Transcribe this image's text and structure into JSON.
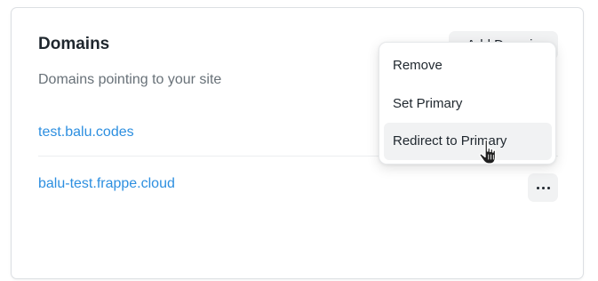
{
  "section": {
    "title": "Domains",
    "subtitle": "Domains pointing to your site",
    "add_button_label": "Add Domain"
  },
  "domains": [
    {
      "name": "test.balu.codes"
    },
    {
      "name": "balu-test.frappe.cloud"
    }
  ],
  "actions_menu": {
    "items": [
      {
        "label": "Remove"
      },
      {
        "label": "Set Primary"
      },
      {
        "label": "Redirect to Primary",
        "highlighted": true
      }
    ]
  },
  "icons": {
    "more_actions": "dots-horizontal-icon",
    "cursor": "hand-pointer-cursor-icon"
  },
  "colors": {
    "link": "#2d8fe0",
    "title": "#1f272e",
    "muted": "#687178",
    "button_bg": "#f1f2f3"
  }
}
